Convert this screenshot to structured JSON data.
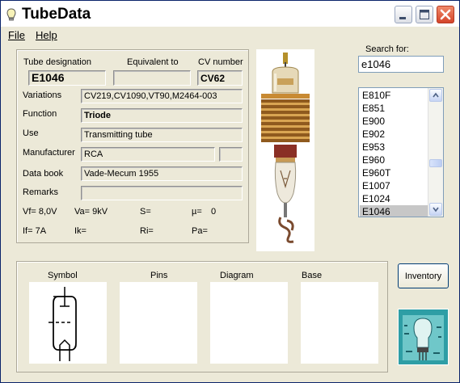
{
  "window": {
    "title": "TubeData"
  },
  "menu": {
    "items": [
      "File",
      "Help"
    ]
  },
  "details": {
    "tube_designation_label": "Tube designation",
    "tube_designation": "E1046",
    "equivalent_label": "Equivalent to",
    "equivalent": "",
    "cv_label": "CV number",
    "cv": "CV62",
    "variations_label": "Variations",
    "variations": "CV219,CV1090,VT90,M2464-003",
    "function_label": "Function",
    "function": "Triode",
    "use_label": "Use",
    "use": "Transmitting tube",
    "manufacturer_label": "Manufacturer",
    "manufacturer": "RCA",
    "manufacturer_extra": "",
    "databook_label": "Data book",
    "databook": "Vade-Mecum 1955",
    "remarks_label": "Remarks",
    "remarks": "",
    "params_row1": [
      "Vf= 8,0V",
      "Va= 9kV",
      "S=",
      "µ=",
      "0"
    ],
    "params_row2": [
      "If= 7A",
      "Ik=",
      "Ri=",
      "Pa="
    ]
  },
  "search": {
    "label": "Search for:",
    "value": "e1046",
    "results": [
      "E810F",
      "E851",
      "E900",
      "E902",
      "E953",
      "E960",
      "E960T",
      "E1007",
      "E1024",
      "E1046"
    ],
    "selected": "E1046"
  },
  "panels": {
    "symbol": "Symbol",
    "pins": "Pins",
    "diagram": "Diagram",
    "base": "Base"
  },
  "buttons": {
    "inventory": "Inventory"
  },
  "colors": {
    "selection": "#c7c7c7",
    "panel_bg": "#ece9d8",
    "close_button": "#d4442a"
  }
}
